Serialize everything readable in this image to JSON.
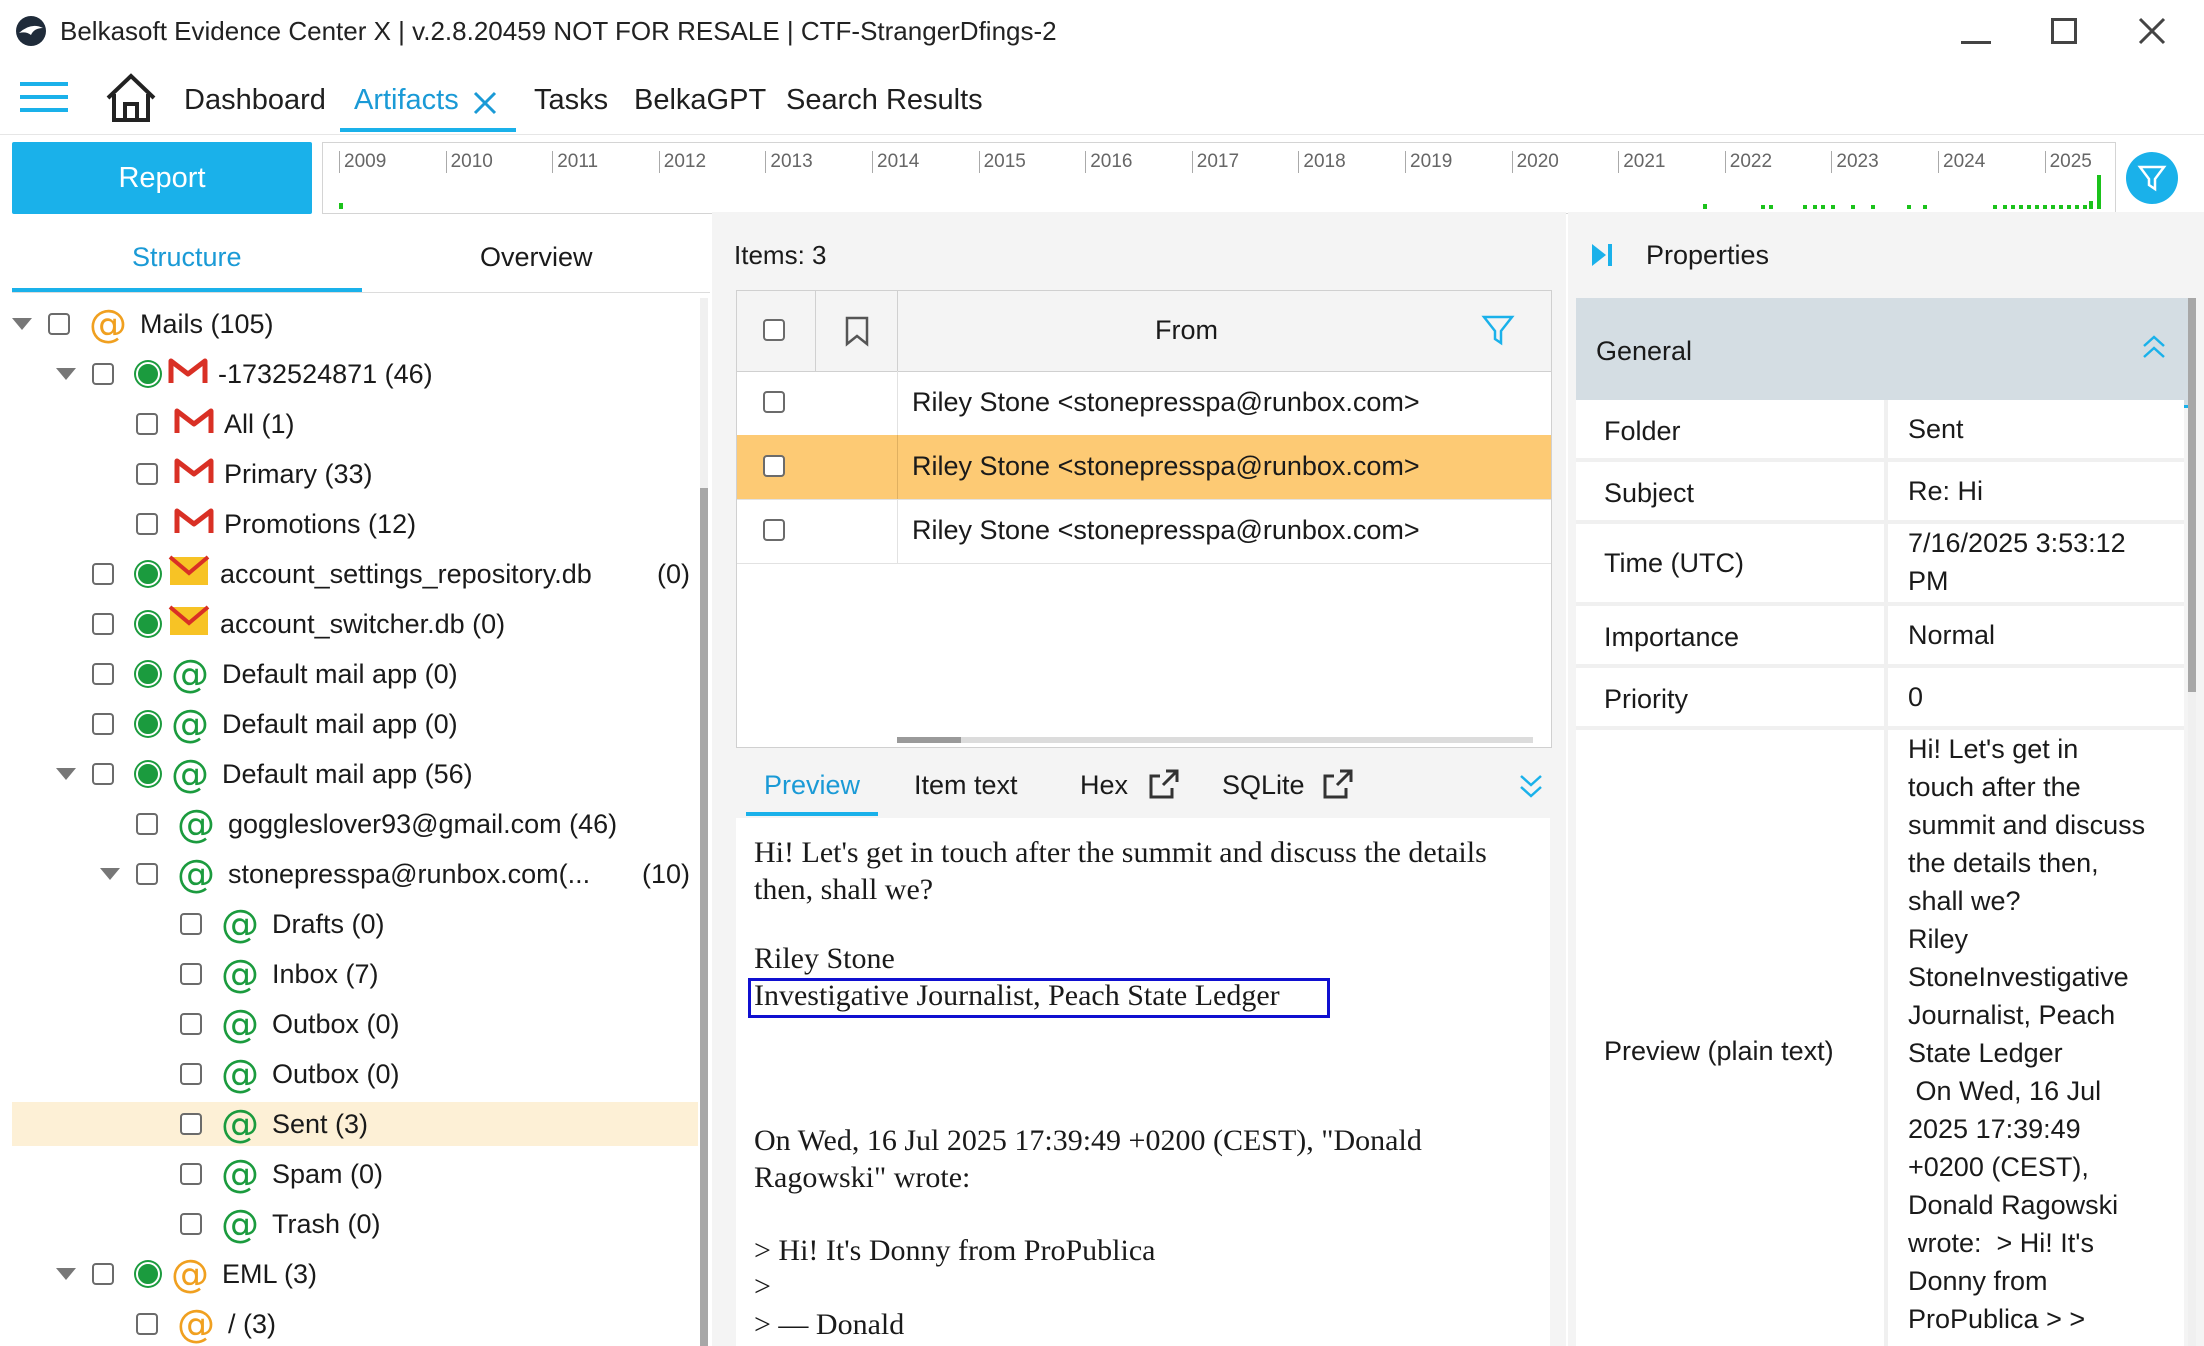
{
  "window": {
    "title": "Belkasoft Evidence Center X | v.2.8.20459 NOT FOR RESALE | CTF-StrangerDfings-2",
    "minimize_icon": "minimize-icon",
    "maximize_icon": "maximize-icon",
    "close_icon": "close-icon"
  },
  "nav": {
    "menu_icon": "hamburger-icon",
    "home_icon": "home-icon",
    "tabs": [
      {
        "label": "Dashboard"
      },
      {
        "label": "Artifacts",
        "active": true
      },
      {
        "label": "Tasks"
      },
      {
        "label": "BelkaGPT"
      },
      {
        "label": "Search Results"
      }
    ]
  },
  "toolbar": {
    "report_label": "Report",
    "timeline_years": [
      "2009",
      "2010",
      "2011",
      "2012",
      "2013",
      "2014",
      "2015",
      "2016",
      "2017",
      "2018",
      "2019",
      "2020",
      "2021",
      "2022",
      "2023",
      "2024",
      "2025"
    ]
  },
  "left": {
    "tabs": [
      "Structure",
      "Overview"
    ],
    "tree": [
      {
        "label": "Mails (105)",
        "level": 0,
        "expanded": true,
        "icon": "at-orange"
      },
      {
        "label": "-1732524871 (46)",
        "level": 1,
        "expanded": true,
        "icon": "gmail",
        "dot": true
      },
      {
        "label": "All (1)",
        "level": 2,
        "icon": "gmail"
      },
      {
        "label": "Primary (33)",
        "level": 2,
        "icon": "gmail"
      },
      {
        "label": "Promotions (12)",
        "level": 2,
        "icon": "gmail"
      },
      {
        "label": "account_settings_repository.db",
        "count": "(0)",
        "level": 1,
        "icon": "envelope",
        "dot": true
      },
      {
        "label": "account_switcher.db (0)",
        "level": 1,
        "icon": "envelope",
        "dot": true
      },
      {
        "label": "Default mail app (0)",
        "level": 1,
        "icon": "at-green",
        "dot": true
      },
      {
        "label": "Default mail app (0)",
        "level": 1,
        "icon": "at-green",
        "dot": true
      },
      {
        "label": "Default mail app (56)",
        "level": 1,
        "expanded": true,
        "icon": "at-green",
        "dot": true
      },
      {
        "label": "goggleslover93@gmail.com (46)",
        "level": 2,
        "icon": "at-green"
      },
      {
        "label": "stonepresspa@runbox.com(...",
        "count": "(10)",
        "level": 2,
        "expanded": true,
        "icon": "at-green"
      },
      {
        "label": "Drafts (0)",
        "level": 3,
        "icon": "at-green"
      },
      {
        "label": "Inbox (7)",
        "level": 3,
        "icon": "at-green"
      },
      {
        "label": "Outbox (0)",
        "level": 3,
        "icon": "at-green"
      },
      {
        "label": "Outbox (0)",
        "level": 3,
        "icon": "at-green"
      },
      {
        "label": "Sent (3)",
        "level": 3,
        "icon": "at-green",
        "selected": true
      },
      {
        "label": "Spam (0)",
        "level": 3,
        "icon": "at-green"
      },
      {
        "label": "Trash (0)",
        "level": 3,
        "icon": "at-green"
      },
      {
        "label": "EML (3)",
        "level": 1,
        "expanded": true,
        "icon": "at-orange",
        "dot": true
      },
      {
        "label": "/ (3)",
        "level": 2,
        "icon": "at-orange"
      }
    ]
  },
  "grid": {
    "items_label": "Items: 3",
    "column_from": "From",
    "rows": [
      {
        "from": "Riley Stone <stonepresspa@runbox.com>"
      },
      {
        "from": "Riley Stone <stonepresspa@runbox.com>",
        "selected": true
      },
      {
        "from": "Riley Stone <stonepresspa@runbox.com>"
      }
    ]
  },
  "preview": {
    "tabs": [
      "Preview",
      "Item text",
      "Hex",
      "SQLite"
    ],
    "lines": [
      "Hi! Let's get in touch after the summit and discuss the details",
      "then, shall we?",
      "Riley Stone",
      "Investigative Journalist, Peach State Ledger",
      "On Wed, 16 Jul 2025 17:39:49 +0200 (CEST), \"Donald",
      "Ragowski\" wrote:",
      "> Hi! It's Donny from ProPublica",
      ">",
      "> — Donald"
    ]
  },
  "properties": {
    "title": "Properties",
    "section": "General",
    "rows": [
      {
        "key": "Folder",
        "value": "Sent"
      },
      {
        "key": "Subject",
        "value": "Re: Hi"
      },
      {
        "key": "Time (UTC)",
        "value_lines": [
          "7/16/2025 3:53:12",
          "PM"
        ]
      },
      {
        "key": "Importance",
        "value": "Normal"
      },
      {
        "key": "Priority",
        "value": "0"
      },
      {
        "key": "Preview (plain text)",
        "value_lines": [
          "Hi! Let's get in",
          "touch after the",
          "summit and discuss",
          "the details then,",
          "shall we?",
          "Riley",
          "StoneInvestigative",
          "Journalist, Peach",
          "State Ledger",
          " On Wed, 16 Jul",
          "2025 17:39:49",
          "+0200 (CEST),",
          "Donald Ragowski",
          "wrote:  > Hi! It's",
          "Donny from",
          "ProPublica > >"
        ]
      }
    ]
  },
  "colors": {
    "accent": "#1ab1ea",
    "selected_row": "#fdca74",
    "selected_tree": "#fdf0d6",
    "green": "#1b9b3e",
    "highlight_box": "#1010d0"
  }
}
